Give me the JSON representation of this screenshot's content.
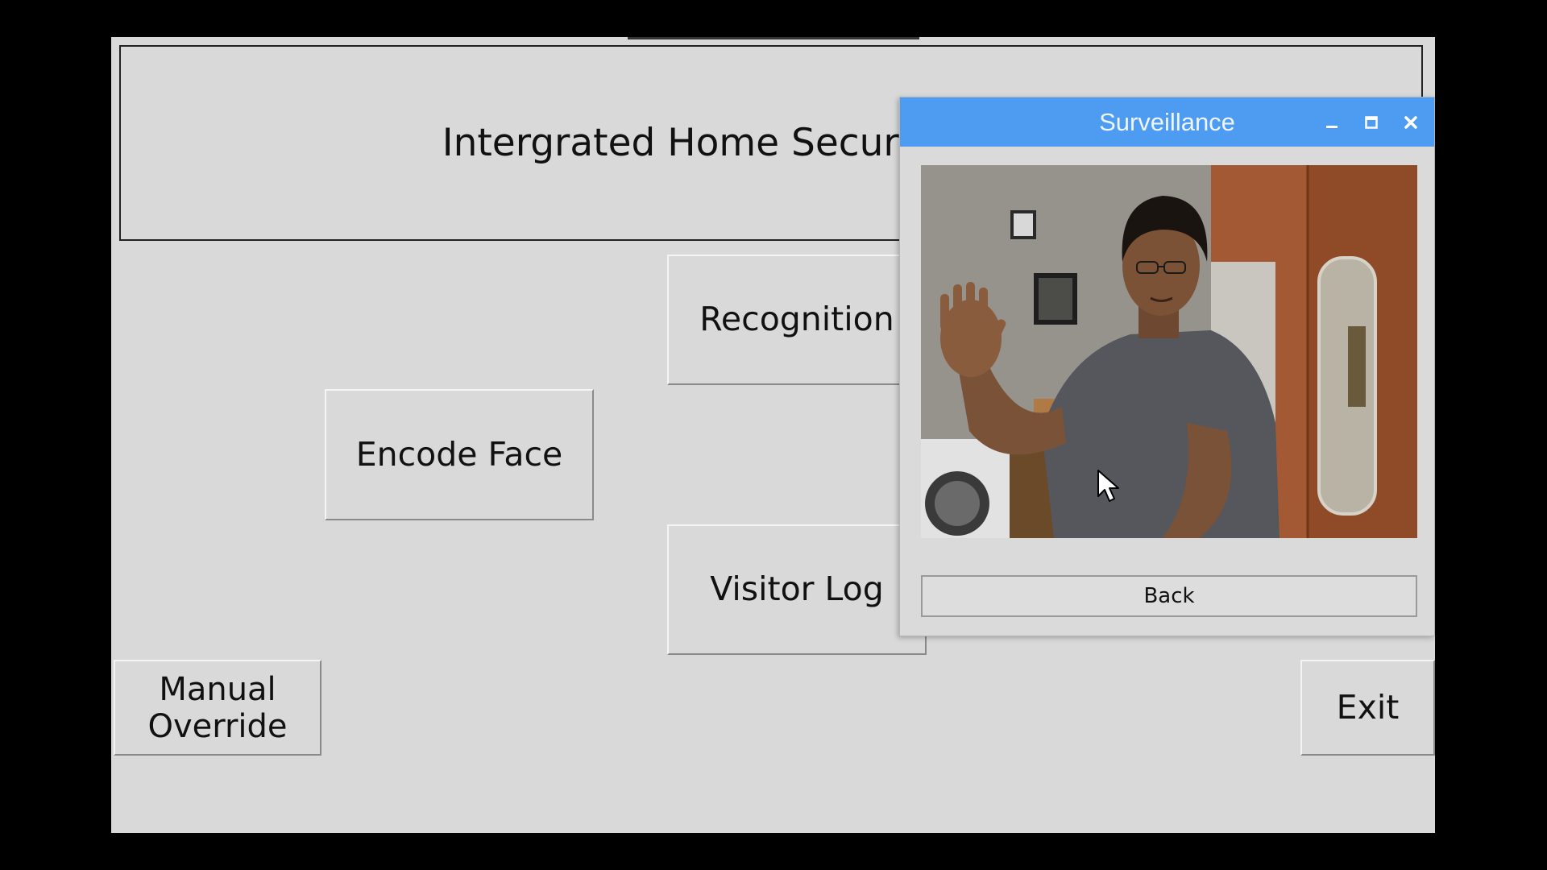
{
  "app": {
    "title": "Intergrated Home Security System",
    "buttons": {
      "recognition": "Recognition",
      "encode_face": "Encode Face",
      "visitor_log": "Visitor Log",
      "manual_override_line1": "Manual",
      "manual_override_line2": "Override",
      "exit": "Exit"
    }
  },
  "popup": {
    "title": "Surveillance",
    "controls": {
      "minimize_icon": "minimize-icon",
      "maximize_icon": "maximize-icon",
      "close_icon": "close-icon"
    },
    "camera_feed": "camera-feed",
    "back_label": "Back"
  },
  "colors": {
    "background": "#000000",
    "app_bg": "#d9d9d9",
    "titlebar": "#4e9bf2"
  }
}
